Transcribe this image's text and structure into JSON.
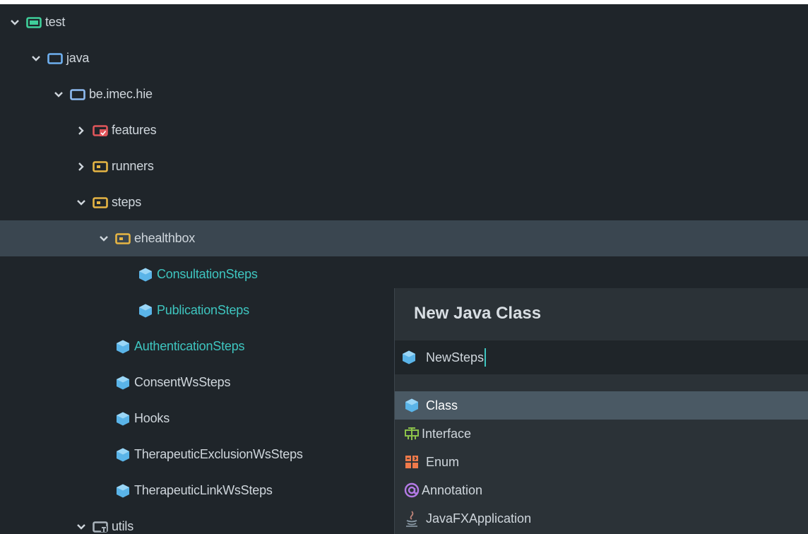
{
  "tree": {
    "items": [
      {
        "label": "test",
        "icon": "test-folder-icon",
        "expanded": true
      },
      {
        "label": "java",
        "icon": "source-folder-icon",
        "expanded": true
      },
      {
        "label": "be.imec.hie",
        "icon": "package-folder-icon",
        "expanded": true
      },
      {
        "label": "features",
        "icon": "resource-folder-icon",
        "expanded": false
      },
      {
        "label": "runners",
        "icon": "package-icon",
        "expanded": false
      },
      {
        "label": "steps",
        "icon": "package-icon",
        "expanded": true
      },
      {
        "label": "ehealthbox",
        "icon": "package-icon",
        "expanded": true
      },
      {
        "label": "ConsultationSteps",
        "icon": "class-icon"
      },
      {
        "label": "PublicationSteps",
        "icon": "class-icon"
      },
      {
        "label": "AuthenticationSteps",
        "icon": "class-icon"
      },
      {
        "label": "ConsentWsSteps",
        "icon": "class-icon"
      },
      {
        "label": "Hooks",
        "icon": "class-icon"
      },
      {
        "label": "TherapeuticExclusionWsSteps",
        "icon": "class-icon"
      },
      {
        "label": "TherapeuticLinkWsSteps",
        "icon": "class-icon"
      },
      {
        "label": "utils",
        "icon": "package-icon",
        "expanded": true
      }
    ]
  },
  "dialog": {
    "title": "New Java Class",
    "name_value": "NewSteps",
    "options": [
      {
        "label": "Class",
        "icon": "class-icon",
        "selected": true
      },
      {
        "label": "Interface",
        "icon": "interface-icon"
      },
      {
        "label": "Enum",
        "icon": "enum-icon"
      },
      {
        "label": "Annotation",
        "icon": "annotation-icon"
      },
      {
        "label": "JavaFXApplication",
        "icon": "javafx-icon"
      }
    ]
  },
  "colors": {
    "background": "#1f252a",
    "selection": "#3a4650",
    "accent": "#3ec6c0",
    "popup": "#2b3237",
    "option_selected": "#4a5964"
  }
}
